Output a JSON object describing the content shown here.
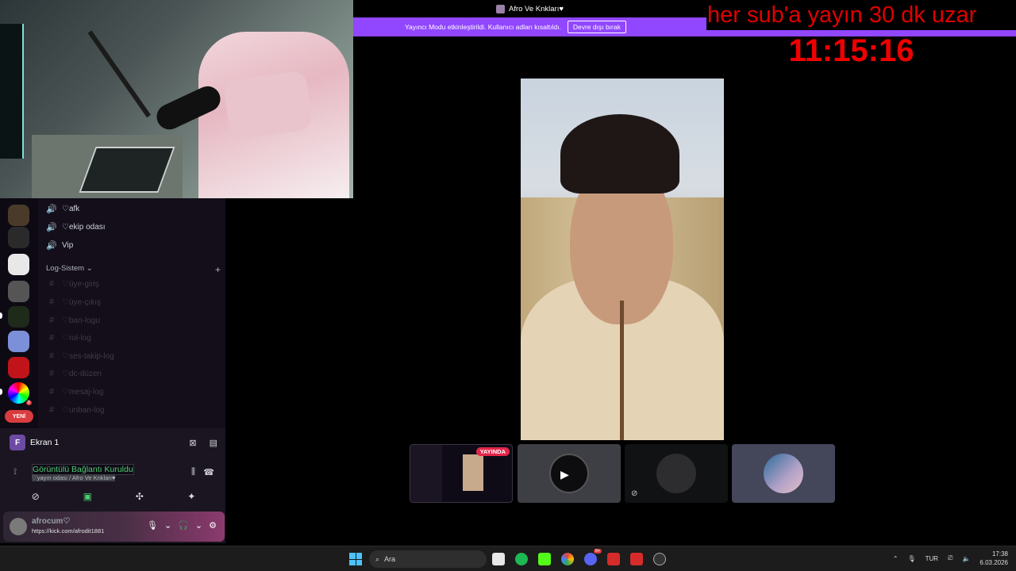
{
  "window": {
    "title": "Afro Ve Knkları♥"
  },
  "streamer_mode": {
    "message": "Yayıncı Modu etkinleştirildi. Kullanıcı adları kısaltıldı.",
    "button_label": "Devre dışı bırak"
  },
  "overlay": {
    "ticker": "her sub'a yayın 30 dk uzar",
    "countdown": "11:15:16",
    "color": "#e00000"
  },
  "guild_bar": {
    "new_badge": "YENİ",
    "badge_count": "8"
  },
  "channels": {
    "voice": [
      {
        "label": "♡afk"
      },
      {
        "label": "♡ekip odası"
      },
      {
        "label": "Vip"
      }
    ],
    "category_label": "Log-Sistem",
    "text": [
      {
        "label": "♡üye-giriş"
      },
      {
        "label": "♡üye-çıkış"
      },
      {
        "label": "♡ban-logu"
      },
      {
        "label": "♡rol-log"
      },
      {
        "label": "♡ses-takip-log"
      },
      {
        "label": "♡dc-düzen"
      },
      {
        "label": "♡mesaj-log"
      },
      {
        "label": "♡unban-log"
      }
    ]
  },
  "screen_share": {
    "initial": "F",
    "label": "Ekran 1"
  },
  "connection": {
    "status": "Görüntülü Bağlantı Kuruldu",
    "location": "♡yayın odası / Afro Ve Knkları♥"
  },
  "user": {
    "name": "afrocum♡",
    "status": "https://kick.com/afrodit1881"
  },
  "stream_tiles": {
    "live_label": "YAYINDA"
  },
  "taskbar": {
    "search_placeholder": "Ara",
    "language": "TUR",
    "time": "17:38",
    "date": "6.03.2026",
    "discord_badge": "9+"
  },
  "colors": {
    "accent_purple": "#9146ff",
    "connected_green": "#4ecb71",
    "live_red": "#e2264a"
  }
}
